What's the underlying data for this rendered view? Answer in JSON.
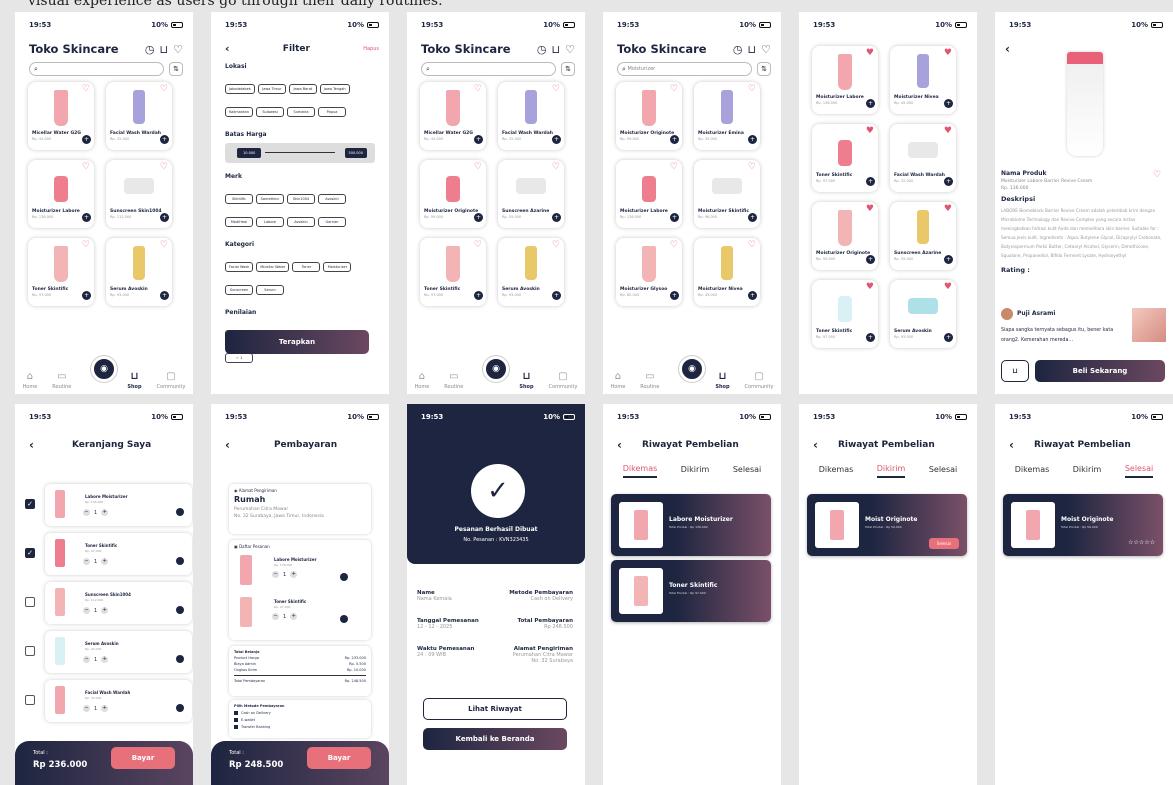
{
  "caption": "visual experience as users go through their daily routines.",
  "status": {
    "time": "19:53",
    "battery": "10%"
  },
  "home": {
    "title": "Toko Skincare",
    "search_placeholder": "",
    "products": [
      {
        "name": "Micellar Water G2G",
        "price": "Rp. 44.000"
      },
      {
        "name": "Facial Wash Wardah",
        "price": "Rp. 32.000"
      },
      {
        "name": "Moisturizer Labore",
        "price": "Rp. 136.000"
      },
      {
        "name": "Sunscreen Skin1004",
        "price": "Rp. 112.000"
      },
      {
        "name": "Toner Skintific",
        "price": "Rp. 97.000"
      },
      {
        "name": "Serum Avoskin",
        "price": "Rp. 93.000"
      }
    ],
    "nav": [
      "Home",
      "Routine",
      "Shop",
      "Community"
    ]
  },
  "filter": {
    "title": "Filter",
    "reset": "Hapus",
    "lokasi_label": "Lokasi",
    "lokasi": [
      "Jabodetabek",
      "Jawa Timur",
      "Jawa Barat",
      "Jawa Tengah",
      "Kalimantan",
      "Sulawesi",
      "Sumatra",
      "Papua"
    ],
    "harga_label": "Batas Harga",
    "harga_min": "10.000",
    "harga_max": "500.000",
    "merk_label": "Merk",
    "merk": [
      "Skintific",
      "Somethinc",
      "Skin1004",
      "Avoskin",
      "MediHeal",
      "Labore",
      "Avoskin",
      "Garnier"
    ],
    "kategori_label": "Kategori",
    "kategori": [
      "Facial Wash",
      "Micellar Water",
      "Toner",
      "Moisturizer",
      "Sunscreen",
      "Serum"
    ],
    "penilaian_label": "Penilaian",
    "penilaian": [
      "☆ 5",
      "☆ 4",
      "☆ 3",
      "☆ 2",
      "☆ 1"
    ],
    "apply": "Terapkan"
  },
  "home2": {
    "products": [
      {
        "name": "Micellar Water G2G",
        "price": "Rp. 44.000"
      },
      {
        "name": "Facial Wash Wardah",
        "price": "Rp. 32.000"
      },
      {
        "name": "Moisturizer Originote",
        "price": "Rp. 59.000"
      },
      {
        "name": "Sunscreen Azarine",
        "price": "Rp. 55.000"
      },
      {
        "name": "Toner Skintific",
        "price": "Rp. 97.000"
      },
      {
        "name": "Serum Avoskin",
        "price": "Rp. 93.000"
      }
    ]
  },
  "search": {
    "query": "Moisturizer",
    "products": [
      {
        "name": "Moisturizer Originote",
        "price": "Rp. 59.000"
      },
      {
        "name": "Moisturizer Emina",
        "price": "Rp. 35.000"
      },
      {
        "name": "Moisturizer Labore",
        "price": "Rp. 136.000"
      },
      {
        "name": "Moisturizer Skintific",
        "price": "Rp. 98.000"
      },
      {
        "name": "Moisturizer Glysoo",
        "price": "Rp. 80.000"
      },
      {
        "name": "Moisturizer Nivea",
        "price": "Rp. 45.000"
      }
    ]
  },
  "wish": {
    "products": [
      {
        "name": "Moisturizer Labore",
        "price": "Rp. 136.000"
      },
      {
        "name": "Moisturizer Nivea",
        "price": "Rp. 45.000"
      },
      {
        "name": "Toner Skintific",
        "price": "Rp. 97.000"
      },
      {
        "name": "Facial Wash Wardah",
        "price": "Rp. 32.000"
      },
      {
        "name": "Moisturizer Originote",
        "price": "Rp. 59.000"
      },
      {
        "name": "Sunscreen Azarine",
        "price": "Rp. 55.000"
      },
      {
        "name": "Toner Skintific",
        "price": "Rp. 97.000"
      },
      {
        "name": "Serum Avoskin",
        "price": "Rp. 93.000"
      }
    ]
  },
  "detail": {
    "name_label": "Nama Produk",
    "name": "Moisturizer Labore Barrier Revive Cream",
    "price": "Rp. 136.000",
    "desc_label": "Deskripsi",
    "desc": "LABORE Biomeblock Barrier Revive Cream adalah pelembab krim dengan Microbiome Technology dan Revive Complex yang secara instan meningkatkan hidrasi kulit Anda dan memelihara skin barrier. Suitable for : Semua jenis kulit. Ingredients : Aqua, Butylene Glycol, Dicaprylyl Carbonate, Butyrospermum Parkii Butter, Cetearyl Alcohol, Glycerin, Dimethicone, Squalane, Propanediol, Bifida Ferment Lysate, Hydroxyethyl",
    "rating_label": "Rating :",
    "reviewer": "Puji Asrami",
    "review": "Siapa sangka ternyata sebagus itu, bener kata orang2. Kemerahan mereda...",
    "buy": "Beli Sekarang"
  },
  "cart": {
    "title": "Keranjang Saya",
    "items": [
      {
        "name": "Labore Moisturizer",
        "price": "Rp. 136.000",
        "qty": "1",
        "checked": true
      },
      {
        "name": "Toner Skintific",
        "price": "Rp. 97.000",
        "qty": "1",
        "checked": true
      },
      {
        "name": "Sunscreen Skin1004",
        "price": "Rp. 112.000",
        "qty": "1",
        "checked": false
      },
      {
        "name": "Serum Avoskin",
        "price": "Rp. 93.000",
        "qty": "1",
        "checked": false
      },
      {
        "name": "Facial Wash Wardah",
        "price": "Rp. 32.000",
        "qty": "1",
        "checked": false
      }
    ],
    "total_label": "Total :",
    "total": "Rp 236.000",
    "pay": "Bayar"
  },
  "payment": {
    "title": "Pembayaran",
    "addr_label": "Alamat Pengiriman",
    "addr_name": "Rumah",
    "addr_line1": "Perumahan Citra Mawar",
    "addr_line2": "No. 32 Surabaya, Jawa Timur, Indonesia",
    "order_label": "Daftar Pesanan",
    "items": [
      {
        "name": "Labore Moisturizer",
        "price": "Rp. 136.000",
        "qty": "1"
      },
      {
        "name": "Toner Skintific",
        "price": "Rp. 97.000",
        "qty": "1"
      }
    ],
    "summary_label": "Total Belanja",
    "summary": [
      {
        "k": "Product Harga",
        "v": "Rp. 233.000"
      },
      {
        "k": "Biaya Admin",
        "v": "Rp. 5.500"
      },
      {
        "k": "Ongkos Kirim",
        "v": "Rp. 10.000"
      }
    ],
    "summary_total_k": "Total Pembayaran",
    "summary_total_v": "Rp. 248.500",
    "method_label": "Pilih Metode Pembayaran",
    "methods": [
      "Cash on Delivery",
      "E-wallet",
      "Transfer Banking"
    ],
    "total_label": "Total :",
    "total": "Rp 248.500",
    "pay": "Bayar"
  },
  "success": {
    "title": "Pesanan Berhasil Dibuat",
    "order_no": "No. Pesanan : KVN323435",
    "name_k": "Name",
    "name_v": "Nama Kemala",
    "method_k": "Metode Pembayaran",
    "method_v": "Cash on Delivery",
    "date_k": "Tanggal Pemesanan",
    "date_v": "12 - 12 - 2025",
    "total_k": "Total Pembayaran",
    "total_v": "Rp 248.500",
    "time_k": "Waktu Pemesanan",
    "time_v": "24 : 09 WIB",
    "addr_k": "Alamat Pengiriman",
    "addr_v1": "Perumahan Citra Mawar",
    "addr_v2": "No. 32 Surabaya",
    "history_btn": "Lihat Riwayat",
    "home_btn": "Kembali ke Beranda"
  },
  "history": {
    "title": "Riwayat Pembelian",
    "tabs": [
      "Dikemas",
      "Dikirim",
      "Selesai"
    ],
    "dikemas": [
      {
        "name": "Labore Moisturizer",
        "sub": "Total Produk : Rp 136.000"
      },
      {
        "name": "Toner Skintific",
        "sub": "Total Produk : Rp 97.000"
      }
    ],
    "dikirim": [
      {
        "name": "Moist Originote",
        "sub": "Total Produk : Rp 59.000",
        "badge": "Selesai"
      }
    ],
    "selesai": [
      {
        "name": "Moist Originote",
        "sub": "Total Produk : Rp 59.000",
        "stars": "☆☆☆☆☆"
      }
    ]
  },
  "colors": {
    "navy": "#1d2540",
    "pink": "#e05573",
    "mauve": "#6b4860"
  }
}
